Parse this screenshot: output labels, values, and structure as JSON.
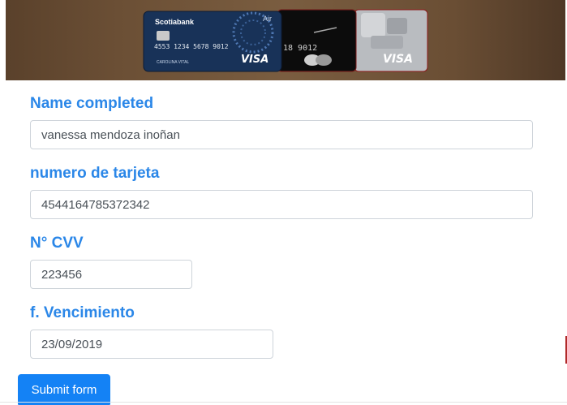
{
  "banner": {
    "card1_bank": "Scotiabank",
    "card1_tag": "Air",
    "card1_number": "4553 1234 5678 9012",
    "card1_holder": "CAROLINA VITAL",
    "card1_brand": "VISA",
    "card2_number": "18 9012",
    "card3_brand": "VISA"
  },
  "form": {
    "name_label": "Name completed",
    "name_value": "vanessa mendoza inoñan",
    "card_label": "numero de tarjeta",
    "card_value": "4544164785372342",
    "cvv_label": "N° CVV",
    "cvv_value": "223456",
    "expiry_label": "f. Vencimiento",
    "expiry_value": "23/09/2019",
    "submit_label": "Submit form"
  },
  "colors": {
    "label": "#2b87e8",
    "button": "#1482f5"
  }
}
